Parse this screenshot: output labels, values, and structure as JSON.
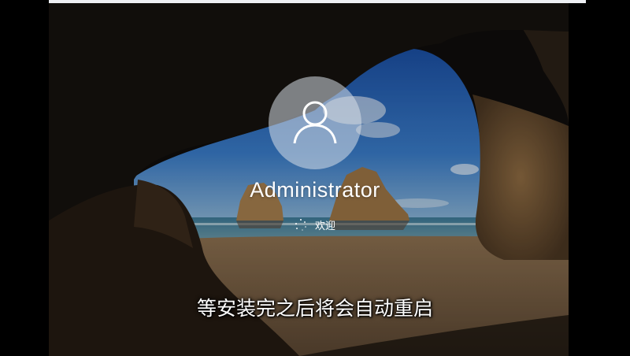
{
  "user": {
    "name": "Administrator",
    "avatar_icon": "user-icon"
  },
  "status": {
    "icon": "spinner-icon",
    "text": "欢迎"
  },
  "caption": {
    "text": "等安装完之后将会自动重启"
  },
  "colors": {
    "sky": "#2a64b8",
    "sea": "#4d87a6",
    "sand": "#9a7a52",
    "cave": "#171410",
    "rock": "#8a6a44"
  }
}
